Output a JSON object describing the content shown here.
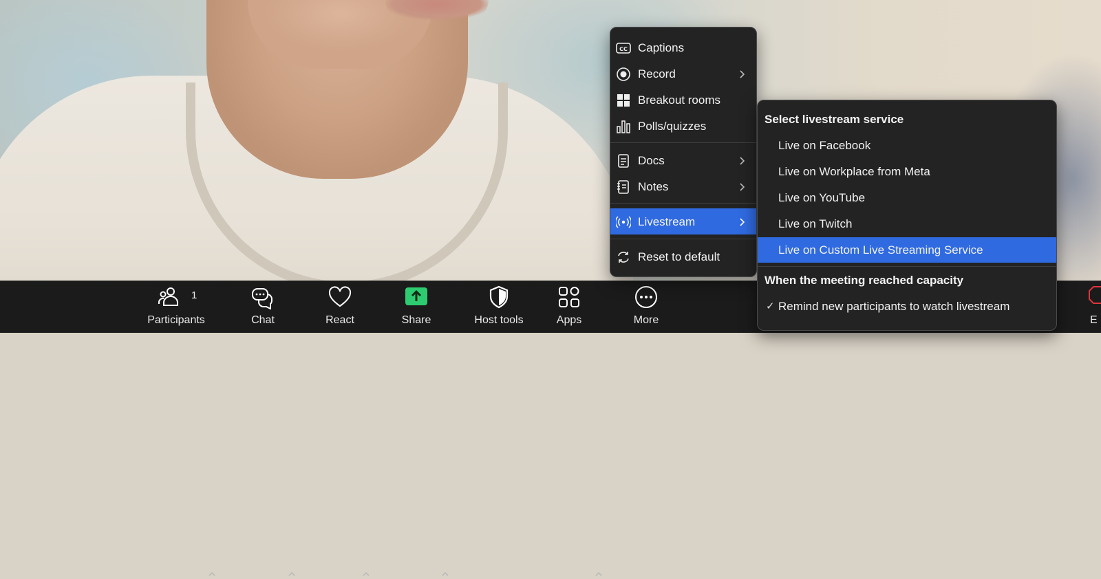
{
  "toolbar": {
    "participants": {
      "label": "Participants",
      "count": "1",
      "icon": "participants-icon"
    },
    "chat": {
      "label": "Chat",
      "icon": "chat-icon"
    },
    "react": {
      "label": "React",
      "icon": "heart-icon"
    },
    "share": {
      "label": "Share",
      "icon": "share-screen-icon",
      "accent": "#2ecc71"
    },
    "host_tools": {
      "label": "Host tools",
      "icon": "shield-icon"
    },
    "apps": {
      "label": "Apps",
      "icon": "apps-icon"
    },
    "more": {
      "label": "More",
      "icon": "more-dots-icon"
    },
    "end_partial": {
      "label": "E",
      "accent": "#e0343b"
    }
  },
  "more_menu": {
    "items": [
      {
        "label": "Captions",
        "icon": "cc-icon",
        "has_submenu": false
      },
      {
        "label": "Record",
        "icon": "record-icon",
        "has_submenu": true
      },
      {
        "label": "Breakout rooms",
        "icon": "grid-icon",
        "has_submenu": false
      },
      {
        "label": "Polls/quizzes",
        "icon": "bar-chart-icon",
        "has_submenu": false
      },
      {
        "label": "Docs",
        "icon": "document-icon",
        "has_submenu": true
      },
      {
        "label": "Notes",
        "icon": "notes-icon",
        "has_submenu": true
      },
      {
        "label": "Livestream",
        "icon": "livestream-icon",
        "has_submenu": true,
        "active": true
      },
      {
        "label": "Reset to default",
        "icon": "reset-icon",
        "has_submenu": false
      }
    ]
  },
  "livestream_menu": {
    "heading": "Select livestream service",
    "services": [
      "Live on Facebook",
      "Live on Workplace from Meta",
      "Live on YouTube",
      "Live on Twitch",
      "Live on Custom Live Streaming Service"
    ],
    "selected_index": 4,
    "capacity_heading": "When the meeting reached capacity",
    "capacity_option": {
      "label": "Remind new participants to watch livestream",
      "checked": true
    }
  },
  "colors": {
    "highlight": "#2f6ae0",
    "menu_bg": "#232323",
    "toolbar_bg": "#1b1b1b"
  }
}
